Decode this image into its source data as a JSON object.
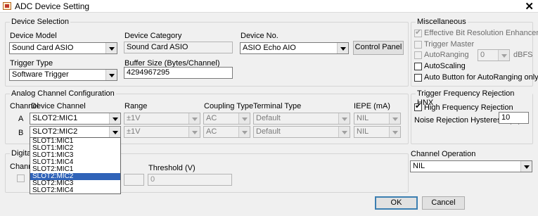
{
  "window": {
    "title": "ADC Device Setting"
  },
  "device_selection": {
    "legend": "Device Selection",
    "model_label": "Device Model",
    "model_value": "Sound Card ASIO",
    "category_label": "Device Category",
    "category_value": "Sound Card ASIO",
    "device_no_label": "Device No.",
    "device_no_value": "ASIO Echo AIO",
    "control_panel_label": "Control Panel",
    "trigger_label": "Trigger Type",
    "trigger_value": "Software Trigger",
    "buffer_label": "Buffer Size (Bytes/Channel)",
    "buffer_value": "4294967295"
  },
  "misc": {
    "legend": "Miscellaneous",
    "effective_bit": "Effective Bit Resolution Enhancement",
    "trigger_master": "Trigger Master",
    "autoranging": "AutoRanging",
    "autoranging_value": "0",
    "dbfs": "dBFS",
    "autoscaling": "AutoScaling",
    "auto_button": "Auto Button for AutoRanging only"
  },
  "analog": {
    "legend": "Analog Channel Configuration",
    "headers": {
      "channel": "Channel",
      "device_channel": "Device Channel",
      "range": "Range",
      "coupling": "Coupling Type",
      "terminal": "Terminal Type",
      "iepe": "IEPE (mA)"
    },
    "rows": [
      {
        "channel": "A",
        "device_channel": "SLOT2:MIC1",
        "range": "±1V",
        "coupling": "AC",
        "terminal": "Default",
        "iepe": "NIL"
      },
      {
        "channel": "B",
        "device_channel": "SLOT2:MIC2",
        "range": "±1V",
        "coupling": "AC",
        "terminal": "Default",
        "iepe": "NIL"
      }
    ],
    "dropdown_options": [
      "SLOT1:MIC1",
      "SLOT1:MIC2",
      "SLOT1:MIC3",
      "SLOT1:MIC4",
      "SLOT2:MIC1",
      "SLOT2:MIC2",
      "SLOT2:MIC3",
      "SLOT2:MIC4"
    ],
    "dropdown_selected": "SLOT2:MIC2"
  },
  "digital": {
    "legend_partial": "Digital C",
    "channel_partial": "Channe",
    "threshold_label": "Threshold (V)",
    "threshold_value": "0"
  },
  "trigger_freq": {
    "legend": "Trigger Frequency Rejection HNX",
    "high_freq": "High Frequency Rejection",
    "noise_label": "Noise Rejection Hysteresis (%)",
    "noise_value": "10"
  },
  "channel_operation": {
    "label": "Channel Operation",
    "value": "NIL"
  },
  "buttons": {
    "ok": "OK",
    "cancel": "Cancel"
  }
}
